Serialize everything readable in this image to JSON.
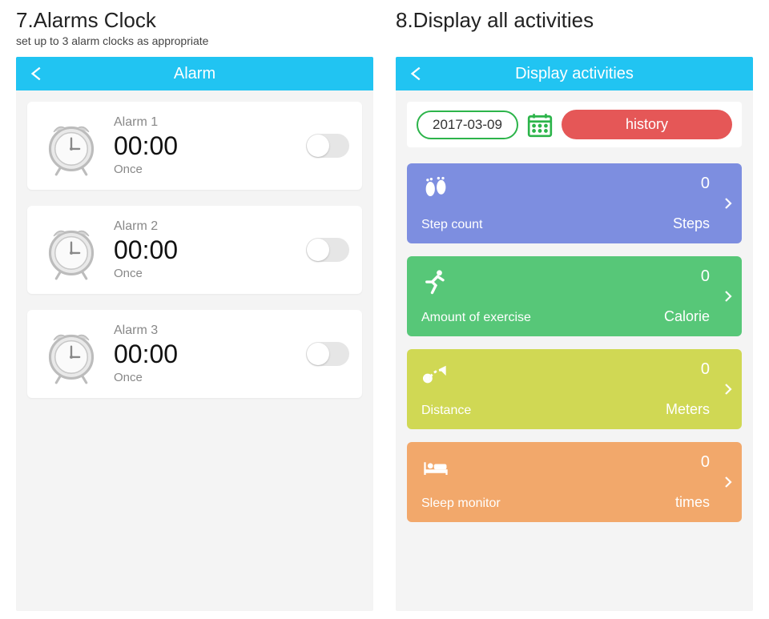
{
  "left": {
    "heading": "7.Alarms Clock",
    "sub": "set up to 3 alarm clocks as appropriate",
    "title": "Alarm",
    "alarms": [
      {
        "name": "Alarm 1",
        "time": "00:00",
        "freq": "Once"
      },
      {
        "name": "Alarm 2",
        "time": "00:00",
        "freq": "Once"
      },
      {
        "name": "Alarm 3",
        "time": "00:00",
        "freq": "Once"
      }
    ]
  },
  "right": {
    "heading": "8.Display all activities",
    "title": "Display activities",
    "date": "2017-03-09",
    "history_label": "history",
    "activities": [
      {
        "label": "Step count",
        "value": "0",
        "unit": "Steps",
        "color": "c-blue",
        "icon": "feet"
      },
      {
        "label": "Amount of exercise",
        "value": "0",
        "unit": "Calorie",
        "color": "c-green",
        "icon": "runner"
      },
      {
        "label": "Distance",
        "value": "0",
        "unit": "Meters",
        "color": "c-yellow",
        "icon": "route"
      },
      {
        "label": "Sleep monitor",
        "value": "0",
        "unit": "times",
        "color": "c-orange",
        "icon": "bed"
      }
    ]
  }
}
